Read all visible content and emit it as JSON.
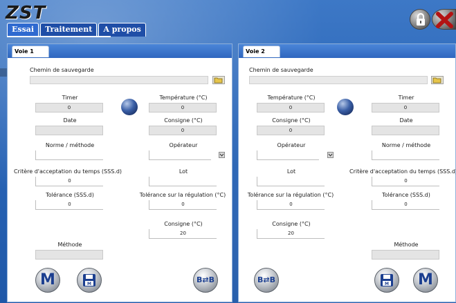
{
  "app": {
    "logo": "ZST",
    "tabs": [
      {
        "label": "Essai",
        "active": true
      },
      {
        "label": "Traitement",
        "active": false
      },
      {
        "label": "A propos",
        "active": false
      }
    ],
    "icons": {
      "lock": "lock-icon",
      "close": "close-icon"
    }
  },
  "voie1": {
    "title": "Voie 1",
    "path_label": "Chemin de sauvegarde",
    "path_value": "",
    "fields": {
      "timer": {
        "label": "Timer",
        "value": "0"
      },
      "date": {
        "label": "Date",
        "value": ""
      },
      "norme": {
        "label": "Norme / méthode",
        "value": ""
      },
      "critere": {
        "label": "Critère d'acceptation du temps (SSS.d)",
        "value": "0"
      },
      "tolerance": {
        "label": "Tolérance (SSS.d)",
        "value": "0"
      },
      "temperature": {
        "label": "Température (°C)",
        "value": "0"
      },
      "consigne": {
        "label": "Consigne (°C)",
        "value": "0"
      },
      "operateur": {
        "label": "Opérateur",
        "value": ""
      },
      "lot": {
        "label": "Lot",
        "value": ""
      },
      "tol_regulation": {
        "label": "Tolérance sur la régulation (°C)",
        "value": "0"
      },
      "consigne2": {
        "label": "Consigne (°C)",
        "value": "20"
      },
      "methode": {
        "label": "Méthode",
        "value": ""
      }
    },
    "buttons": {
      "m": "M",
      "save": "💾",
      "transfer": "B⇄B"
    }
  },
  "voie2": {
    "title": "Voie 2",
    "path_label": "Chemin de sauvegarde",
    "path_value": "",
    "fields": {
      "temperature": {
        "label": "Température (°C)",
        "value": "0"
      },
      "consigne": {
        "label": "Consigne (°C)",
        "value": "0"
      },
      "operateur": {
        "label": "Opérateur",
        "value": ""
      },
      "lot": {
        "label": "Lot",
        "value": ""
      },
      "tol_regulation": {
        "label": "Tolérance sur la régulation (°C)",
        "value": "0"
      },
      "consigne2": {
        "label": "Consigne (°C)",
        "value": "20"
      },
      "timer": {
        "label": "Timer",
        "value": "0"
      },
      "date": {
        "label": "Date",
        "value": ""
      },
      "norme": {
        "label": "Norme / méthode",
        "value": ""
      },
      "critere": {
        "label": "Critère d'acceptation du temps (SSS.d)",
        "value": "0"
      },
      "tolerance": {
        "label": "Tolérance (SSS.d)",
        "value": "0"
      },
      "methode": {
        "label": "Méthode",
        "value": ""
      }
    },
    "buttons": {
      "m": "M",
      "save": "💾",
      "transfer": "B⇄B"
    }
  },
  "colors": {
    "background": "#2a66b8",
    "tab_active": "#2f6ad0",
    "tab": "#1f4ea7",
    "panel_header": "#2f66bf",
    "button_glyph": "#1c3f90"
  }
}
